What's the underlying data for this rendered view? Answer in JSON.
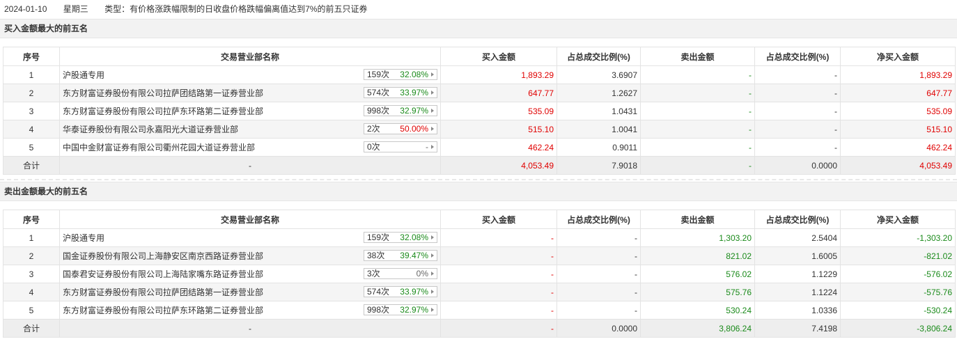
{
  "header": {
    "date": "2024-01-10",
    "weekday": "星期三",
    "type_text": "类型：有价格涨跌幅限制的日收盘价格跌幅偏离值达到7%的前五只证券"
  },
  "buy_section": {
    "title": "买入金额最大的前五名",
    "columns": [
      "序号",
      "交易营业部名称",
      "买入金额",
      "占总成交比例(%)",
      "卖出金额",
      "占总成交比例(%)",
      "净买入金额"
    ],
    "rows": [
      {
        "idx": "1",
        "name": "沪股通专用",
        "count": "159次",
        "rate": "32.08%",
        "buy": "1,893.29",
        "buy_pct": "3.6907",
        "sell": "-",
        "sell_pct": "-",
        "net": "1,893.29"
      },
      {
        "idx": "2",
        "name": "东方财富证券股份有限公司拉萨团结路第一证券营业部",
        "count": "574次",
        "rate": "33.97%",
        "buy": "647.77",
        "buy_pct": "1.2627",
        "sell": "-",
        "sell_pct": "-",
        "net": "647.77"
      },
      {
        "idx": "3",
        "name": "东方财富证券股份有限公司拉萨东环路第二证券营业部",
        "count": "998次",
        "rate": "32.97%",
        "buy": "535.09",
        "buy_pct": "1.0431",
        "sell": "-",
        "sell_pct": "-",
        "net": "535.09"
      },
      {
        "idx": "4",
        "name": "华泰证券股份有限公司永嘉阳光大道证券营业部",
        "count": "2次",
        "rate": "50.00%",
        "buy": "515.10",
        "buy_pct": "1.0041",
        "sell": "-",
        "sell_pct": "-",
        "net": "515.10"
      },
      {
        "idx": "5",
        "name": "中国中金财富证券有限公司衢州花园大道证券营业部",
        "count": "0次",
        "rate": "-",
        "buy": "462.24",
        "buy_pct": "0.9011",
        "sell": "-",
        "sell_pct": "-",
        "net": "462.24"
      }
    ],
    "total": {
      "label": "合计",
      "name": "-",
      "buy": "4,053.49",
      "buy_pct": "7.9018",
      "sell": "-",
      "sell_pct": "0.0000",
      "net": "4,053.49"
    }
  },
  "sell_section": {
    "title": "卖出金额最大的前五名",
    "columns": [
      "序号",
      "交易营业部名称",
      "买入金额",
      "占总成交比例(%)",
      "卖出金额",
      "占总成交比例(%)",
      "净买入金额"
    ],
    "rows": [
      {
        "idx": "1",
        "name": "沪股通专用",
        "count": "159次",
        "rate": "32.08%",
        "buy": "-",
        "buy_pct": "-",
        "sell": "1,303.20",
        "sell_pct": "2.5404",
        "net": "-1,303.20"
      },
      {
        "idx": "2",
        "name": "国金证券股份有限公司上海静安区南京西路证券营业部",
        "count": "38次",
        "rate": "39.47%",
        "buy": "-",
        "buy_pct": "-",
        "sell": "821.02",
        "sell_pct": "1.6005",
        "net": "-821.02"
      },
      {
        "idx": "3",
        "name": "国泰君安证券股份有限公司上海陆家嘴东路证券营业部",
        "count": "3次",
        "rate": "0%",
        "buy": "-",
        "buy_pct": "-",
        "sell": "576.02",
        "sell_pct": "1.1229",
        "net": "-576.02"
      },
      {
        "idx": "4",
        "name": "东方财富证券股份有限公司拉萨团结路第一证券营业部",
        "count": "574次",
        "rate": "33.97%",
        "buy": "-",
        "buy_pct": "-",
        "sell": "575.76",
        "sell_pct": "1.1224",
        "net": "-575.76"
      },
      {
        "idx": "5",
        "name": "东方财富证券股份有限公司拉萨东环路第二证券营业部",
        "count": "998次",
        "rate": "32.97%",
        "buy": "-",
        "buy_pct": "-",
        "sell": "530.24",
        "sell_pct": "1.0336",
        "net": "-530.24"
      }
    ],
    "total": {
      "label": "合计",
      "name": "-",
      "buy": "-",
      "buy_pct": "0.0000",
      "sell": "3,806.24",
      "sell_pct": "7.4198",
      "net": "-3,806.24"
    }
  },
  "colors": {
    "positive": "#e00000",
    "negative": "#1a8a1a",
    "rate_green": "#1a8a1a",
    "rate_red": "#e00000"
  }
}
